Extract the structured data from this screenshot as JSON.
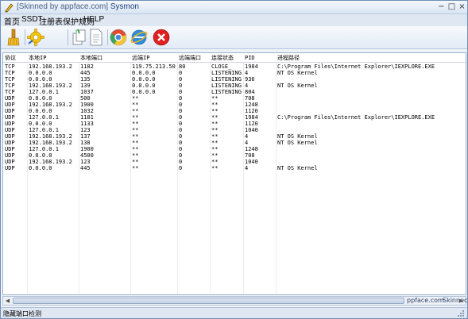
{
  "window": {
    "title_prefix": "[Skinned by appface.com]",
    "title_app": "Sysmon",
    "min_glyph": "−",
    "max_glyph": "□",
    "close_glyph": "×"
  },
  "menu": [
    "首页",
    "SSDT",
    "注册表保护规则",
    "HELP"
  ],
  "toolbar": [
    {
      "icon": "broom-icon"
    },
    {
      "icon": "gear-icon"
    },
    {
      "icon": "copy-icon"
    },
    {
      "icon": "document-icon"
    },
    {
      "icon": "chrome-ball-icon"
    },
    {
      "icon": "internet-explorer-icon"
    },
    {
      "icon": "stop-icon"
    }
  ],
  "table": {
    "headers": [
      "协议",
      "本地IP",
      "本地端口",
      "远端IP",
      "远端端口",
      "连接状态",
      "PID",
      "进程路径"
    ],
    "rows": [
      [
        "TCP",
        "192.168.193.2",
        "1182",
        "119.75.213.50",
        "80",
        "CLOSE_",
        "1984",
        "C:\\Program Files\\Internet Explorer\\IEXPLORE.EXE"
      ],
      [
        "TCP",
        "0.0.0.0",
        "445",
        "0.0.0.0",
        "0",
        "LISTENING",
        "4",
        "NT OS Kernel"
      ],
      [
        "TCP",
        "0.0.0.0",
        "135",
        "0.0.0.0",
        "0",
        "LISTENING",
        "936",
        ""
      ],
      [
        "TCP",
        "192.168.193.2",
        "139",
        "0.0.0.0",
        "0",
        "LISTENING",
        "4",
        "NT OS Kernel"
      ],
      [
        "TCP",
        "127.0.0.1",
        "1037",
        "0.0.0.0",
        "0",
        "LISTENING",
        "804",
        ""
      ],
      [
        "UDP",
        "0.0.0.0",
        "500",
        "**",
        "0",
        "**",
        "708",
        ""
      ],
      [
        "UDP",
        "192.168.193.2",
        "1900",
        "**",
        "0",
        "**",
        "1248",
        ""
      ],
      [
        "UDP",
        "0.0.0.0",
        "1032",
        "**",
        "0",
        "**",
        "1120",
        ""
      ],
      [
        "UDP",
        "127.0.0.1",
        "1181",
        "**",
        "0",
        "**",
        "1984",
        "C:\\Program Files\\Internet Explorer\\IEXPLORE.EXE"
      ],
      [
        "UDP",
        "0.0.0.0",
        "1133",
        "**",
        "0",
        "**",
        "1120",
        ""
      ],
      [
        "UDP",
        "127.0.0.1",
        "123",
        "**",
        "0",
        "**",
        "1040",
        ""
      ],
      [
        "UDP",
        "192.168.193.2",
        "137",
        "**",
        "0",
        "**",
        "4",
        "NT OS Kernel"
      ],
      [
        "UDP",
        "192.168.193.2",
        "138",
        "**",
        "0",
        "**",
        "4",
        "NT OS Kernel"
      ],
      [
        "UDP",
        "127.0.0.1",
        "1900",
        "**",
        "0",
        "**",
        "1248",
        ""
      ],
      [
        "UDP",
        "0.0.0.0",
        "4500",
        "**",
        "0",
        "**",
        "708",
        ""
      ],
      [
        "UDP",
        "192.168.193.2",
        "123",
        "**",
        "0",
        "**",
        "1040",
        ""
      ],
      [
        "UDP",
        "0.0.0.0",
        "445",
        "**",
        "0",
        "**",
        "4",
        "NT OS Kernel"
      ]
    ]
  },
  "scrollbar": {
    "watermark_left": "ppface.com",
    "watermark_right": "Skinnec"
  },
  "status": "隐藏端口检测"
}
